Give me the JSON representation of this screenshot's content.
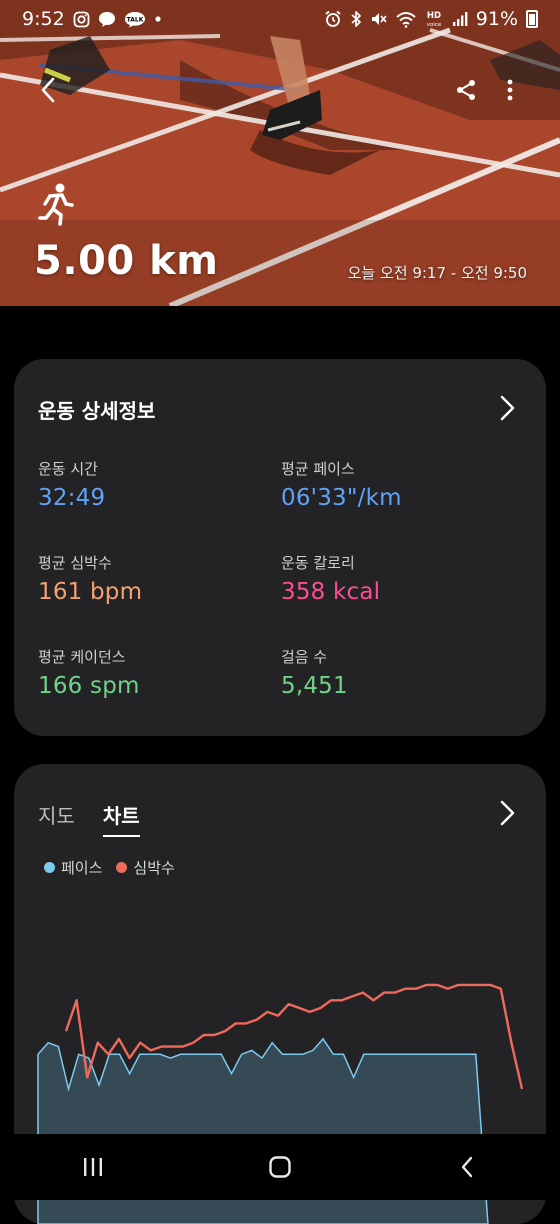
{
  "status_bar": {
    "time": "9:52",
    "left_icons": [
      "instagram-icon",
      "chat-bubble-icon",
      "kakaotalk-icon",
      "dot-icon"
    ],
    "right_icons": [
      "alarm-icon",
      "bluetooth-icon",
      "mute-icon",
      "wifi-icon",
      "hd-voice-icon",
      "signal-icon",
      "battery-icon"
    ],
    "battery": "91%",
    "hd_voice": "HD"
  },
  "hero": {
    "activity_icon": "running-icon",
    "distance": "5.00 km",
    "time_range": "오늘 오전 9:17 - 오전 9:50",
    "track_color": "#b64a2c"
  },
  "details": {
    "title": "운동 상세정보",
    "stats": [
      {
        "label": "운동 시간",
        "value": "32:49",
        "color": "#5fa2f8"
      },
      {
        "label": "평균 페이스",
        "value": "06'33\"/km",
        "color": "#5fa2f8"
      },
      {
        "label": "평균 심박수",
        "value": "161 bpm",
        "color": "#f4a271"
      },
      {
        "label": "운동 칼로리",
        "value": "358 kcal",
        "color": "#ff4f8f"
      },
      {
        "label": "평균 케이던스",
        "value": "166 spm",
        "color": "#6fd48a"
      },
      {
        "label": "걸음 수",
        "value": "5,451",
        "color": "#6fd48a"
      }
    ]
  },
  "chart_card": {
    "tabs": [
      "지도",
      "차트"
    ],
    "active_tab": "차트"
  },
  "chart_data": {
    "type": "area",
    "legend": [
      {
        "name": "페이스",
        "color": "#7dc9f0"
      },
      {
        "name": "심박수",
        "color": "#f06a5c"
      }
    ],
    "series": [
      {
        "name": "페이스",
        "color": "#7dc9f0",
        "values": [
          44,
          47,
          46,
          35,
          44,
          43,
          36,
          44,
          44,
          39,
          44,
          44,
          44,
          43,
          44,
          44,
          44,
          44,
          44,
          39,
          44,
          45,
          43,
          47,
          44,
          44,
          44,
          45,
          48,
          44,
          44,
          38,
          44,
          44,
          44,
          44,
          44,
          44,
          44,
          44,
          44,
          44,
          44,
          44,
          0
        ]
      },
      {
        "name": "심박수",
        "color": "#f06a5c",
        "values": [
          50,
          58,
          38,
          47,
          44,
          48,
          43,
          47,
          45,
          46,
          46,
          46,
          47,
          49,
          49,
          50,
          52,
          52,
          53,
          55,
          54,
          57,
          56,
          55,
          56,
          58,
          58,
          59,
          60,
          58,
          60,
          60,
          61,
          61,
          62,
          62,
          61,
          62,
          62,
          62,
          62,
          61,
          47,
          35
        ]
      }
    ]
  },
  "nav_bar": {
    "buttons": [
      "recent-apps-icon",
      "home-icon",
      "back-icon"
    ]
  }
}
